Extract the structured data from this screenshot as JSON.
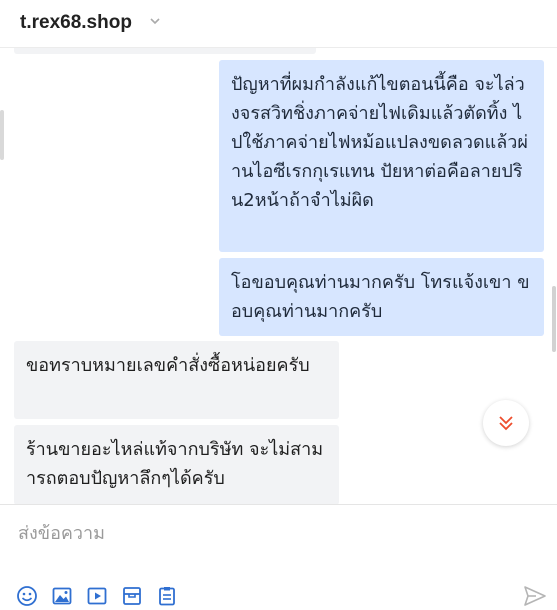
{
  "header": {
    "shop_name": "t.rex68.shop",
    "chevron_icon": "chevron-down-icon"
  },
  "messages": [
    {
      "side": "out",
      "text": "ปัญหาที่ผมกำลังแก้ไขตอนนี้คือ จะไล่วงจรสวิทชิ่งภาคจ่ายไฟเดิมแล้วตัดทิ้ง ไปใช้ภาคจ่ายไฟหม้อแปลงขดลวดแล้วผ่านไอซีเรกกุเรแทน ปัยหาต่อคือลายปริน2หน้าถ้าจำไม่ผิด"
    },
    {
      "side": "out",
      "text": "โอขอบคุณท่านมากครับ โทรแจ้งเขา ขอบคุณท่านมากครับ"
    },
    {
      "side": "in",
      "text": "ขอทราบหมายเลขคำสั่งซื้อหน่อยครับ"
    },
    {
      "side": "in",
      "text": "ร้านขายอะไหล่แท้จากบริษัท จะไม่สามารถตอบปัญหาลึกๆได้ครับ"
    }
  ],
  "scroll_down_icon": "double-chevron-down-icon",
  "composer": {
    "placeholder": "ส่งข้อความ",
    "value": "",
    "tools": [
      "emoji-icon",
      "image-icon",
      "video-icon",
      "product-icon",
      "order-icon"
    ],
    "send_icon": "send-icon"
  },
  "colors": {
    "outgoing_bubble": "#d7e6ff",
    "incoming_bubble": "#f2f3f5",
    "accent": "#ee4d2d",
    "icon_blue": "#2f6fd1"
  }
}
